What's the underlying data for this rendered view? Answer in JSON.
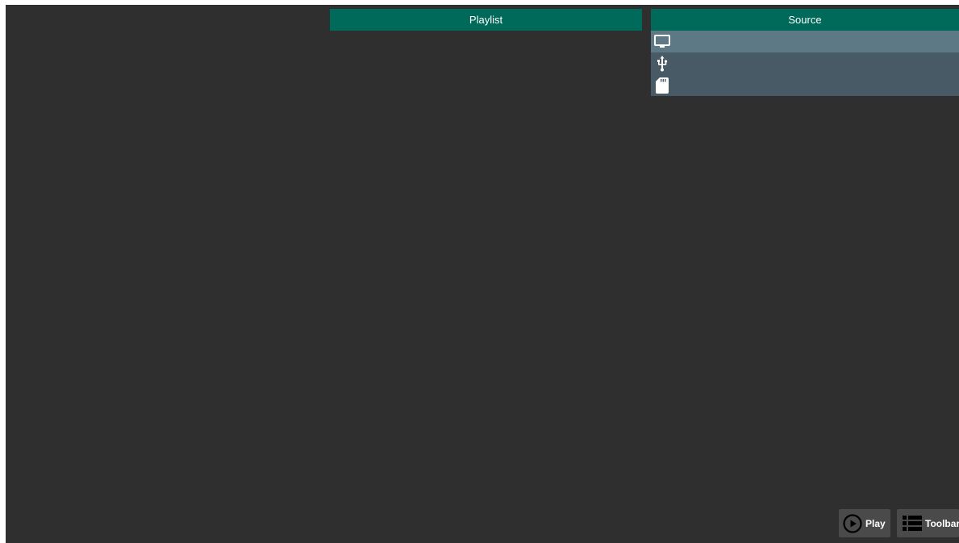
{
  "panels": {
    "playlist_title": "Playlist",
    "source_title": "Source"
  },
  "source": {
    "items": [
      {
        "icon": "tv-icon",
        "selected": true
      },
      {
        "icon": "usb-icon",
        "selected": false
      },
      {
        "icon": "sd-card-icon",
        "selected": false
      }
    ]
  },
  "buttons": {
    "play_label": "Play",
    "toolbar_label": "Toolbar",
    "play_icon": "play-circle-icon",
    "toolbar_icon": "list-icon"
  },
  "colors": {
    "background": "#2f2f2f",
    "header": "#006a5a",
    "source_item": "#485a66",
    "source_item_selected": "#5d7986",
    "button": "#4a4a4a"
  }
}
